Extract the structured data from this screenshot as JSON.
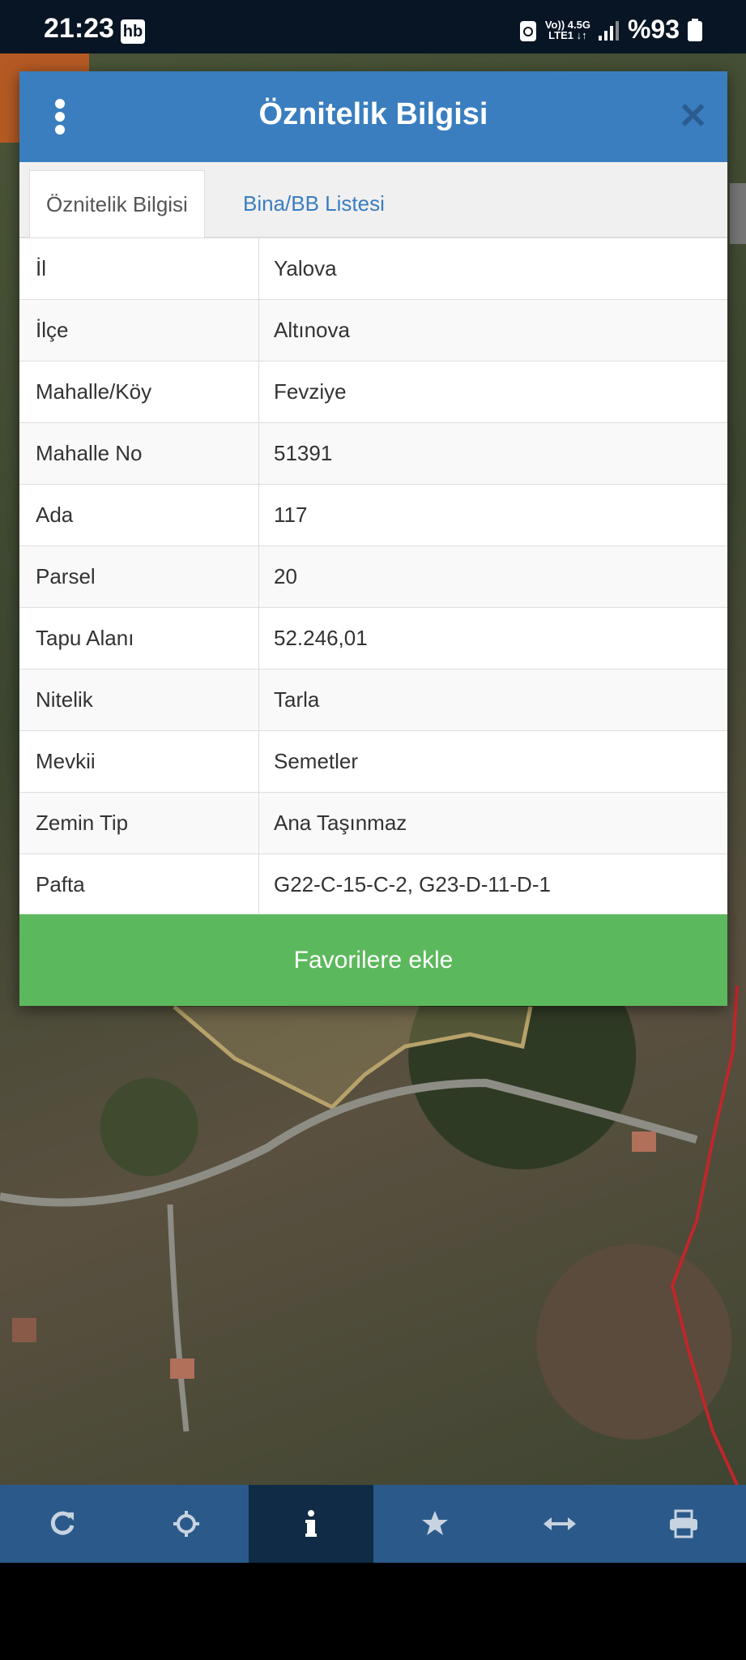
{
  "status_bar": {
    "time": "21:23",
    "hb_badge": "hb",
    "network_top": "Vo)) 4.5G",
    "network_bottom": "LTE1 ↓↑",
    "battery": "%93"
  },
  "modal": {
    "title": "Öznitelik Bilgisi",
    "tabs": [
      {
        "label": "Öznitelik Bilgisi",
        "active": true
      },
      {
        "label": "Bina/BB Listesi",
        "active": false
      }
    ],
    "rows": [
      {
        "key": "İl",
        "value": "Yalova"
      },
      {
        "key": "İlçe",
        "value": "Altınova"
      },
      {
        "key": "Mahalle/Köy",
        "value": "Fevziye"
      },
      {
        "key": "Mahalle No",
        "value": "51391"
      },
      {
        "key": "Ada",
        "value": "117"
      },
      {
        "key": "Parsel",
        "value": "20"
      },
      {
        "key": "Tapu Alanı",
        "value": "52.246,01"
      },
      {
        "key": "Nitelik",
        "value": "Tarla"
      },
      {
        "key": "Mevkii",
        "value": "Semetler"
      },
      {
        "key": "Zemin Tip",
        "value": "Ana Taşınmaz"
      },
      {
        "key": "Pafta",
        "value": "G22-C-15-C-2, G23-D-11-D-1"
      }
    ],
    "favorite_button": "Favorilere ekle"
  },
  "toolbar": [
    {
      "icon": "refresh-icon",
      "active": false
    },
    {
      "icon": "locate-icon",
      "active": false
    },
    {
      "icon": "info-icon",
      "active": true
    },
    {
      "icon": "star-icon",
      "active": false
    },
    {
      "icon": "measure-icon",
      "active": false
    },
    {
      "icon": "print-icon",
      "active": false
    }
  ],
  "colors": {
    "header": "#3a7ebf",
    "favorite": "#5cb85c",
    "toolbar": "#2b5a8a",
    "toolbar_active": "#0f2b45"
  }
}
